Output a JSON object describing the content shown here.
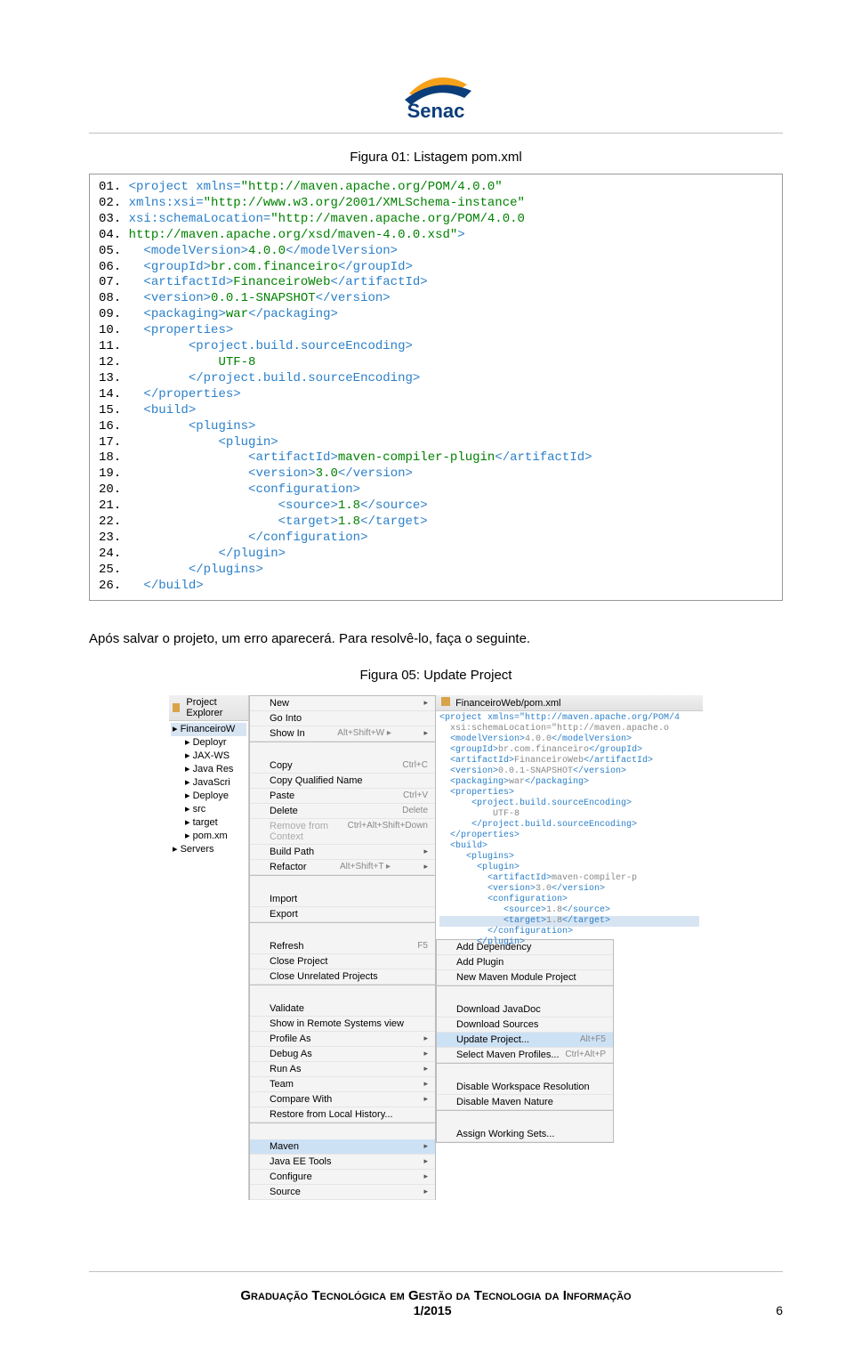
{
  "logo_text": "Senac",
  "fig1_title": "Figura 01: Listagem pom.xml",
  "code_lines": [
    {
      "n": "01.",
      "tag": "<project xmlns=",
      "val": "\"http://maven.apache.org/POM/4.0.0\"",
      "close": ""
    },
    {
      "n": "02.",
      "tag": "xmlns:xsi=",
      "val": "\"http://www.w3.org/2001/XMLSchema-instance\"",
      "close": ""
    },
    {
      "n": "03.",
      "tag": "xsi:schemaLocation=",
      "val": "\"http://maven.apache.org/POM/4.0.0",
      "close": ""
    },
    {
      "n": "04.",
      "tag": "",
      "val": "http://maven.apache.org/xsd/maven-4.0.0.xsd\"",
      "close": ">"
    },
    {
      "n": "05.",
      "tag": "  <modelVersion>",
      "val": "4.0.0",
      "close": "</modelVersion>"
    },
    {
      "n": "06.",
      "tag": "  <groupId>",
      "val": "br.com.financeiro",
      "close": "</groupId>"
    },
    {
      "n": "07.",
      "tag": "  <artifactId>",
      "val": "FinanceiroWeb",
      "close": "</artifactId>"
    },
    {
      "n": "08.",
      "tag": "  <version>",
      "val": "0.0.1-SNAPSHOT",
      "close": "</version>"
    },
    {
      "n": "09.",
      "tag": "  <packaging>",
      "val": "war",
      "close": "</packaging>"
    },
    {
      "n": "10.",
      "tag": "  <properties>",
      "val": "",
      "close": ""
    },
    {
      "n": "11.",
      "tag": "        <project.build.sourceEncoding>",
      "val": "",
      "close": ""
    },
    {
      "n": "12.",
      "tag": "            ",
      "val": "UTF-8",
      "close": ""
    },
    {
      "n": "13.",
      "tag": "        </project.build.sourceEncoding>",
      "val": "",
      "close": ""
    },
    {
      "n": "14.",
      "tag": "  </properties>",
      "val": "",
      "close": ""
    },
    {
      "n": "15.",
      "tag": "  <build>",
      "val": "",
      "close": ""
    },
    {
      "n": "16.",
      "tag": "        <plugins>",
      "val": "",
      "close": ""
    },
    {
      "n": "17.",
      "tag": "            <plugin>",
      "val": "",
      "close": ""
    },
    {
      "n": "18.",
      "tag": "                <artifactId>",
      "val": "maven-compiler-plugin",
      "close": "</artifactId>"
    },
    {
      "n": "19.",
      "tag": "                <version>",
      "val": "3.0",
      "close": "</version>"
    },
    {
      "n": "20.",
      "tag": "                <configuration>",
      "val": "",
      "close": ""
    },
    {
      "n": "21.",
      "tag": "                    <source>",
      "val": "1.8",
      "close": "</source>"
    },
    {
      "n": "22.",
      "tag": "                    <target>",
      "val": "1.8",
      "close": "</target>"
    },
    {
      "n": "23.",
      "tag": "                </configuration>",
      "val": "",
      "close": ""
    },
    {
      "n": "24.",
      "tag": "            </plugin>",
      "val": "",
      "close": ""
    },
    {
      "n": "25.",
      "tag": "        </plugins>",
      "val": "",
      "close": ""
    },
    {
      "n": "26.",
      "tag": "  </build>",
      "val": "",
      "close": ""
    }
  ],
  "body_text": "Após salvar o projeto, um erro aparecerá. Para resolvê-lo, faça o seguinte.",
  "fig5_title": "Figura 05: Update Project",
  "explorer_title": "Project Explorer",
  "tree": [
    "FinanceiroW",
    "Deployr",
    "JAX-WS",
    "Java Res",
    "JavaScri",
    "Deploye",
    "src",
    "target",
    "pom.xm",
    "Servers"
  ],
  "context_menu": [
    {
      "label": "New",
      "sc": "",
      "arrow": true
    },
    {
      "label": "Go Into",
      "sc": ""
    },
    {
      "label": "Show In",
      "sc": "Alt+Shift+W ▸",
      "arrow": true,
      "sep": true
    },
    {
      "label": "Copy",
      "sc": "Ctrl+C"
    },
    {
      "label": "Copy Qualified Name",
      "sc": ""
    },
    {
      "label": "Paste",
      "sc": "Ctrl+V"
    },
    {
      "label": "Delete",
      "sc": "Delete"
    },
    {
      "label": "Remove from Context",
      "sc": "Ctrl+Alt+Shift+Down",
      "dis": true
    },
    {
      "label": "Build Path",
      "sc": "",
      "arrow": true
    },
    {
      "label": "Refactor",
      "sc": "Alt+Shift+T ▸",
      "arrow": true,
      "sep": true
    },
    {
      "label": "Import",
      "sc": ""
    },
    {
      "label": "Export",
      "sc": "",
      "sep": true
    },
    {
      "label": "Refresh",
      "sc": "F5"
    },
    {
      "label": "Close Project",
      "sc": ""
    },
    {
      "label": "Close Unrelated Projects",
      "sc": "",
      "sep": true
    },
    {
      "label": "Validate",
      "sc": ""
    },
    {
      "label": "Show in Remote Systems view",
      "sc": ""
    },
    {
      "label": "Profile As",
      "sc": "",
      "arrow": true
    },
    {
      "label": "Debug As",
      "sc": "",
      "arrow": true
    },
    {
      "label": "Run As",
      "sc": "",
      "arrow": true
    },
    {
      "label": "Team",
      "sc": "",
      "arrow": true
    },
    {
      "label": "Compare With",
      "sc": "",
      "arrow": true
    },
    {
      "label": "Restore from Local History...",
      "sc": "",
      "sep": true
    },
    {
      "label": "Maven",
      "sc": "",
      "arrow": true,
      "sel": true
    },
    {
      "label": "Java EE Tools",
      "sc": "",
      "arrow": true
    },
    {
      "label": "Configure",
      "sc": "",
      "arrow": true
    },
    {
      "label": "Source",
      "sc": "",
      "arrow": true
    }
  ],
  "submenu": [
    {
      "label": "Add Dependency"
    },
    {
      "label": "Add Plugin"
    },
    {
      "label": "New Maven Module Project",
      "sep": true
    },
    {
      "label": "Download JavaDoc"
    },
    {
      "label": "Download Sources"
    },
    {
      "label": "Update Project...",
      "sc": "Alt+F5",
      "sel": true
    },
    {
      "label": "Select Maven Profiles...",
      "sc": "Ctrl+Alt+P",
      "sep": true
    },
    {
      "label": "Disable Workspace Resolution"
    },
    {
      "label": "Disable Maven Nature",
      "sep": true
    },
    {
      "label": "Assign Working Sets..."
    }
  ],
  "editor_tab": "FinanceiroWeb/pom.xml",
  "editor_lines": [
    "<project xmlns=\"http://maven.apache.org/POM/4",
    "  xsi:schemaLocation=\"http://maven.apache.o",
    "  <modelVersion>4.0.0</modelVersion>",
    "  <groupId>br.com.financeiro</groupId>",
    "  <artifactId>FinanceiroWeb</artifactId>",
    "  <version>0.0.1-SNAPSHOT</version>",
    "  <packaging>war</packaging>",
    "  <properties>",
    "      <project.build.sourceEncoding>",
    "          UTF-8",
    "      </project.build.sourceEncoding>",
    "  </properties>",
    "  <build>",
    "     <plugins>",
    "       <plugin>",
    "         <artifactId>maven-compiler-p",
    "         <version>3.0</version>",
    "         <configuration>",
    "            <source>1.8</source>",
    "            <target>1.8</target>",
    "         </configuration>",
    "       </plugin>"
  ],
  "footer_course": "Graduação Tecnológica em Gestão da Tecnologia da Informação",
  "footer_date": "1/2015",
  "footer_page": "6"
}
